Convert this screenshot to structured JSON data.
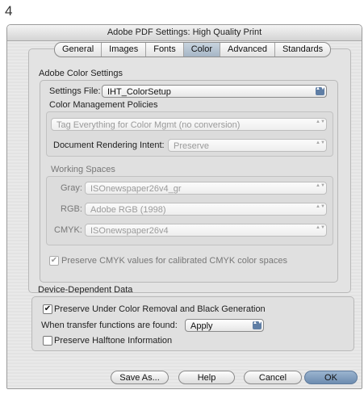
{
  "page_number": "4",
  "window": {
    "title": "Adobe PDF Settings: High Quality Print"
  },
  "tabs": [
    {
      "label": "General",
      "active": false
    },
    {
      "label": "Images",
      "active": false
    },
    {
      "label": "Fonts",
      "active": false
    },
    {
      "label": "Color",
      "active": true
    },
    {
      "label": "Advanced",
      "active": false
    },
    {
      "label": "Standards",
      "active": false
    }
  ],
  "color_settings": {
    "section_title": "Adobe Color Settings",
    "settings_file_label": "Settings File:",
    "settings_file_value": "IHT_ColorSetup",
    "policies_title": "Color Management Policies",
    "policy_value": "Tag Everything for Color Mgmt (no conversion)",
    "intent_label": "Document Rendering Intent:",
    "intent_value": "Preserve",
    "working_spaces_title": "Working Spaces",
    "gray_label": "Gray:",
    "gray_value": "ISOnewspaper26v4_gr",
    "rgb_label": "RGB:",
    "rgb_value": "Adobe RGB (1998)",
    "cmyk_label": "CMYK:",
    "cmyk_value": "ISOnewspaper26v4",
    "preserve_cmyk_label": "Preserve CMYK values for calibrated CMYK color spaces",
    "preserve_cmyk_checked": true
  },
  "device_data": {
    "section_title": "Device-Dependent Data",
    "ucr_label": "Preserve Under Color Removal and Black Generation",
    "ucr_checked": true,
    "transfer_label": "When transfer functions are found:",
    "transfer_value": "Apply",
    "halftone_label": "Preserve Halftone Information",
    "halftone_checked": false
  },
  "buttons": {
    "save_as": "Save As...",
    "help": "Help",
    "cancel": "Cancel",
    "ok": "OK"
  },
  "glyphs": {
    "check": "✔",
    "popup_arrows": "▲▼"
  },
  "colors": {
    "active_tab": "#b4c3d3",
    "default_button": "#7a97b9",
    "popup_arrow_bg": "#5f7ea5"
  }
}
